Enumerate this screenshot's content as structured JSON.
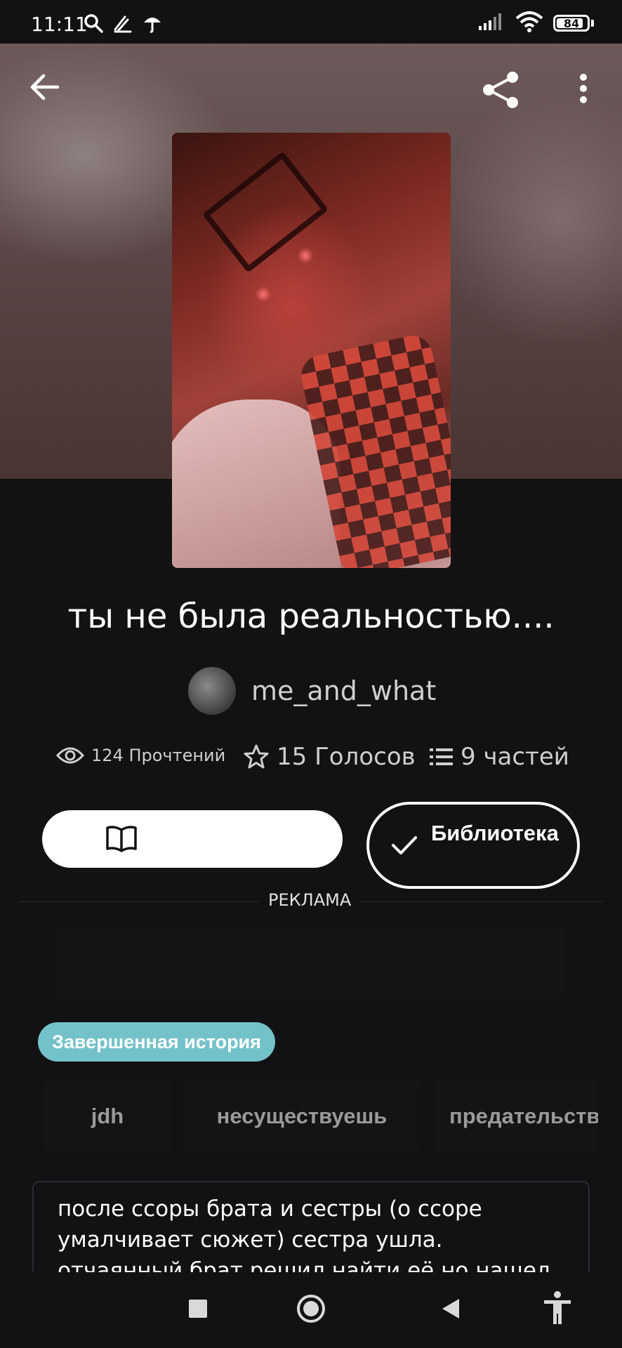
{
  "status_bar": {
    "time": "11:11",
    "battery": "84",
    "icons": [
      "search-icon",
      "wind-icon",
      "umbrella-icon",
      "signal-icon",
      "wifi-icon",
      "battery-icon"
    ]
  },
  "top_bar": {
    "icons": [
      "back-arrow-icon",
      "share-icon",
      "more-vertical-icon"
    ]
  },
  "story": {
    "title": "ты не была реальностью....",
    "author": "me_and_what",
    "stats": {
      "reads": "124 Прочтений",
      "votes": "15 Голосов",
      "parts": "9 частей"
    }
  },
  "actions": {
    "read_icon": "open-book-icon",
    "library_label": "Библиотека"
  },
  "ad": {
    "label": "РЕКЛАМА"
  },
  "badge": {
    "label": "Завершенная история",
    "color": "#74c2c9"
  },
  "tags": [
    "jdh",
    "несуществуешь",
    "предательство"
  ],
  "description": "после ссоры брата и сестры (о ссоре умалчивает сюжет) сестра ушла. отчаянный брат решил найти её но нашел нечто...",
  "nav": {
    "icons": [
      "recents-square-icon",
      "home-circle-icon",
      "back-triangle-icon",
      "accessibility-icon"
    ]
  }
}
